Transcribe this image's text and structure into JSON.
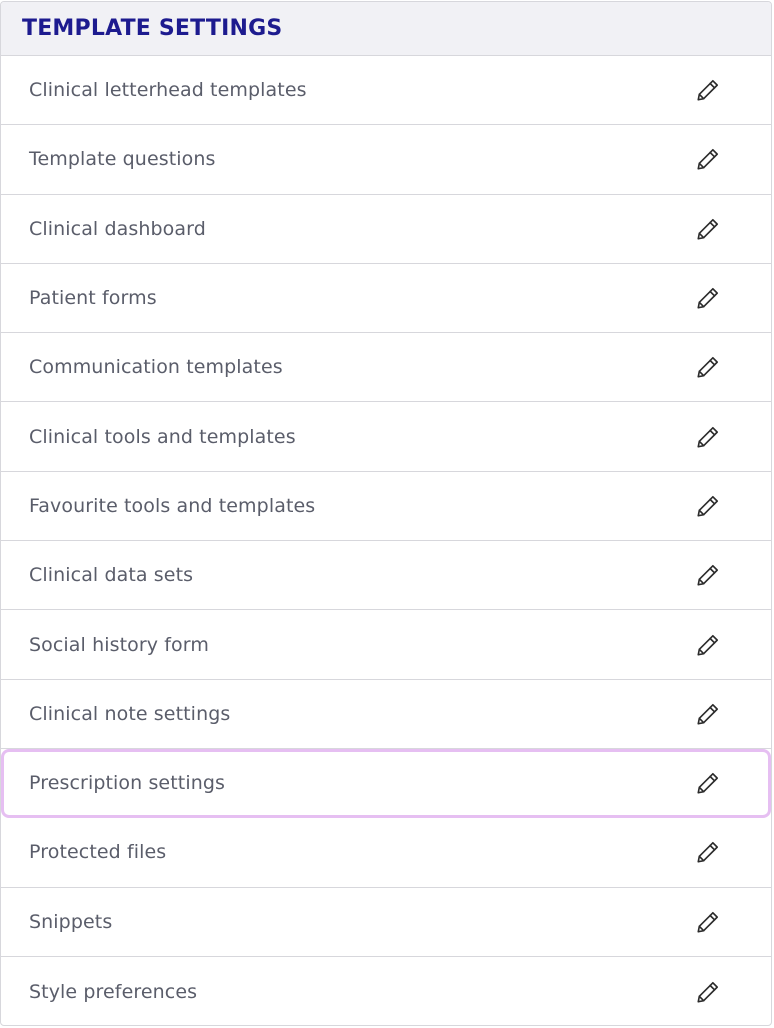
{
  "panel": {
    "title": "TEMPLATE SETTINGS",
    "highlighted_index": 10,
    "edit_icon": "pencil-icon",
    "colors": {
      "title": "#1d1b8f",
      "header_bg": "#f1f1f5",
      "label": "#5a5d6a",
      "highlight": "#e6bff2",
      "divider": "#d7d7dc"
    },
    "items": [
      {
        "label": "Clinical letterhead templates"
      },
      {
        "label": "Template questions"
      },
      {
        "label": "Clinical dashboard"
      },
      {
        "label": "Patient forms"
      },
      {
        "label": "Communication templates"
      },
      {
        "label": "Clinical tools and templates"
      },
      {
        "label": "Favourite tools and templates"
      },
      {
        "label": "Clinical data sets"
      },
      {
        "label": "Social history form"
      },
      {
        "label": "Clinical note settings"
      },
      {
        "label": "Prescription settings"
      },
      {
        "label": "Protected files"
      },
      {
        "label": "Snippets"
      },
      {
        "label": "Style preferences"
      }
    ]
  }
}
